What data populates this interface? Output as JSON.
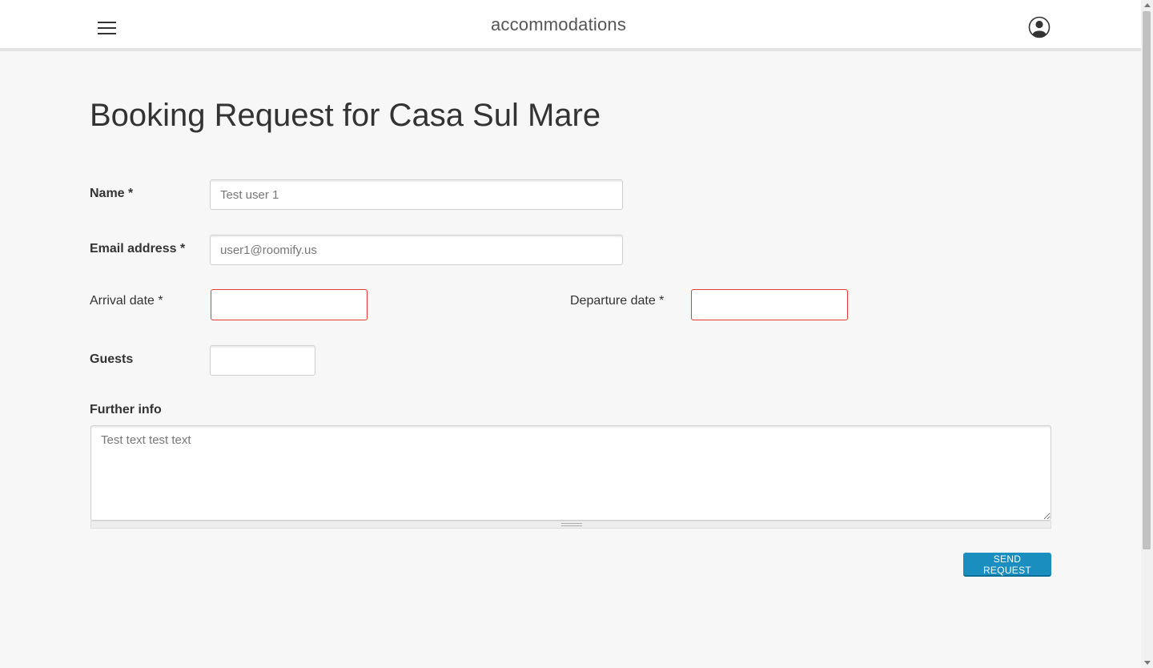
{
  "header": {
    "site_title": "accommodations"
  },
  "page": {
    "title": "Booking Request for Casa Sul Mare"
  },
  "form": {
    "name_label": "Name *",
    "name_value": "Test user 1",
    "email_label": "Email address *",
    "email_value": "user1@roomify.us",
    "arrival_label": "Arrival date *",
    "arrival_value": "",
    "departure_label": "Departure date *",
    "departure_value": "",
    "guests_label": "Guests",
    "guests_value": "",
    "info_label": "Further info",
    "info_value": "Test text test text",
    "submit_label": "SEND REQUEST"
  },
  "colors": {
    "accent": "#1a8ebf",
    "error_border": "#e53935",
    "background": "#f7f7f7"
  },
  "icons": {
    "menu": "hamburger-menu-icon",
    "user": "user-account-icon"
  }
}
